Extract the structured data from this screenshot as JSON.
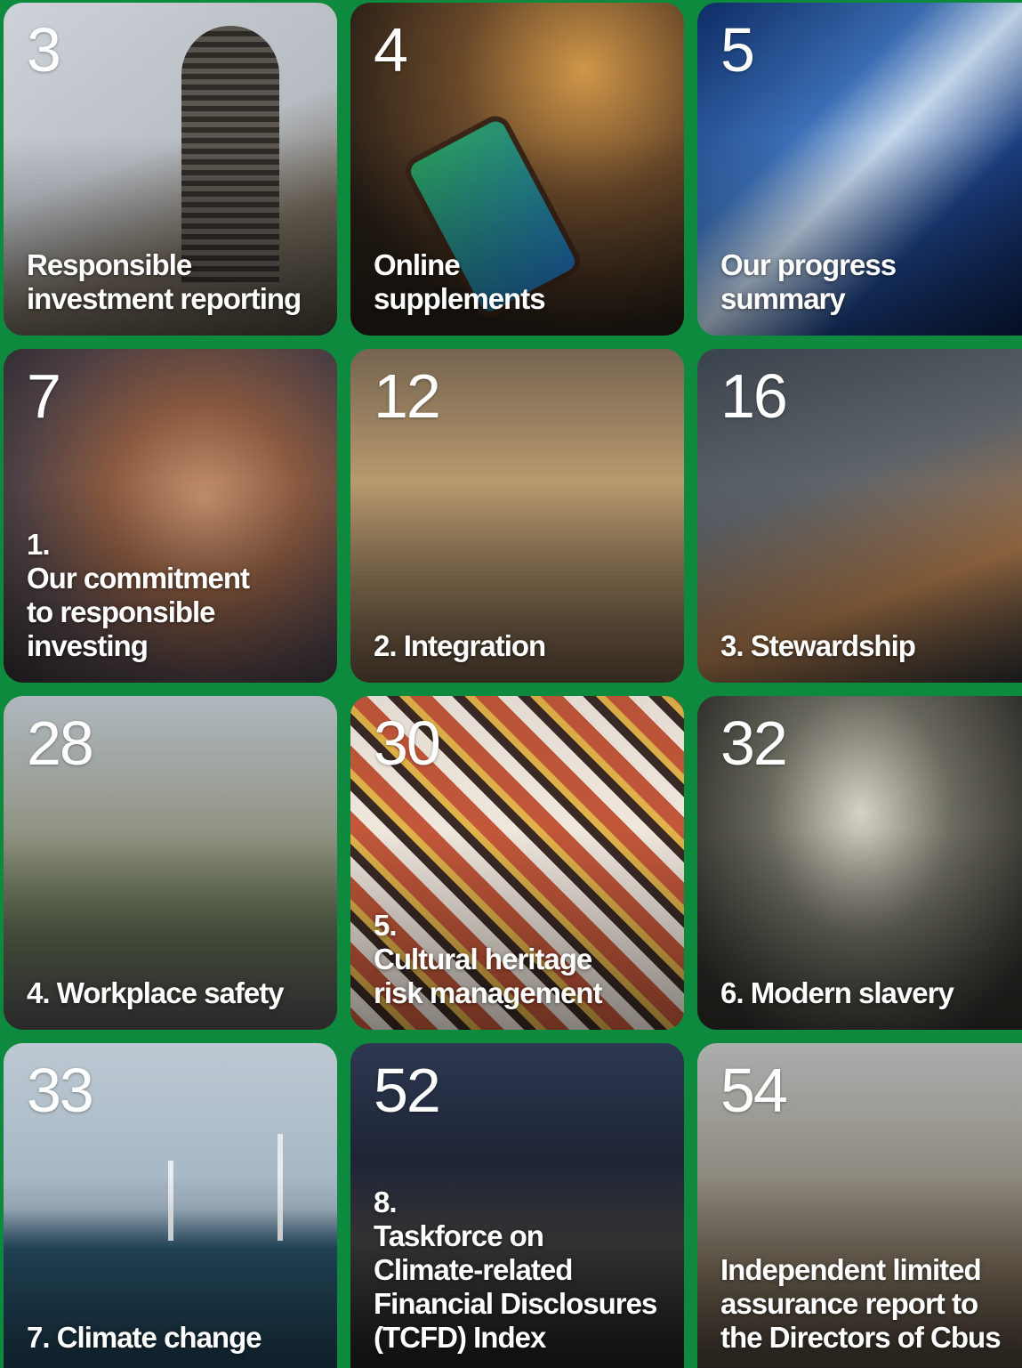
{
  "tiles": [
    {
      "page": "3",
      "title": "Responsible\ninvestment reporting"
    },
    {
      "page": "4",
      "title": "Online\nsupplements"
    },
    {
      "page": "5",
      "title": "Our progress\nsummary"
    },
    {
      "page": "7",
      "title": "1.\nOur commitment\nto responsible\ninvesting"
    },
    {
      "page": "12",
      "title": "2. Integration"
    },
    {
      "page": "16",
      "title": "3. Stewardship"
    },
    {
      "page": "28",
      "title": "4. Workplace safety"
    },
    {
      "page": "30",
      "title": "5.\nCultural heritage\nrisk management"
    },
    {
      "page": "32",
      "title": "6. Modern slavery"
    },
    {
      "page": "33",
      "title": "7. Climate change"
    },
    {
      "page": "52",
      "title": "8.\nTaskforce on\nClimate-related\nFinancial Disclosures\n(TCFD) Index"
    },
    {
      "page": "54",
      "title": "Independent limited\nassurance report to\nthe Directors of Cbus"
    }
  ],
  "colors": {
    "background": "#0e8a3e",
    "text": "#ffffff"
  }
}
